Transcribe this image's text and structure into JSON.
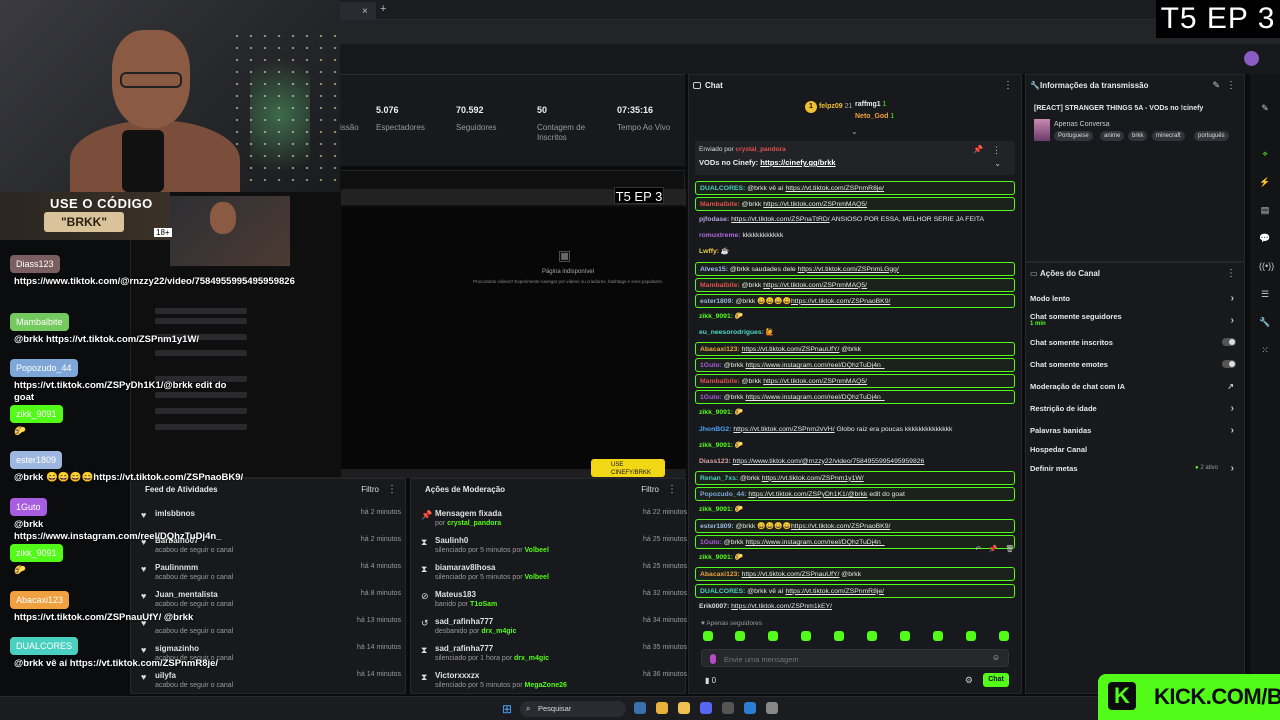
{
  "overlay": {
    "episode_label": "T5 EP 3",
    "episode_label_small": "T5 EP 3",
    "promo": {
      "title": "USE O CÓDIGO",
      "code": "\"BRKK\"",
      "badge": "18+"
    },
    "chat": [
      {
        "name": "Diass123",
        "color": "#d9a3a3",
        "msg": "https://www.tiktok.com/@rnzzy22/video/7584955995495959826"
      },
      {
        "name": "Mambalbite",
        "color": "#74c95f",
        "msg": "@brkk https://vt.tiktok.com/ZSPnm1y1W/"
      },
      {
        "name": "Popozudo_44",
        "color": "#7ea6d9",
        "msg": "https://vt.tiktok.com/ZSPyDh1K1/@brkk edit do goat"
      },
      {
        "name": "zikk_9091",
        "color": "#53fc18",
        "msg": "🌮"
      },
      {
        "name": "ester1809",
        "color": "#9db7e0",
        "msg": "@brkk 😄😄😄😄https://vt.tiktok.com/ZSPnaoBK9/"
      },
      {
        "name": "1Guto",
        "color": "#a85ce0",
        "msg": "@brkk https://www.instagram.com/reel/DQhzTuDj4n_"
      },
      {
        "name": "zikk_9091",
        "color": "#53fc18",
        "msg": "🌮"
      },
      {
        "name": "Abacaxi123",
        "color": "#f0a040",
        "msg": "https://vt.tiktok.com/ZSPnauUfY/ @brkk"
      },
      {
        "name": "DUALCORES",
        "color": "#4ad0c0",
        "msg": "@brkk vê aí https://vt.tiktok.com/ZSPnmR8je/"
      }
    ]
  },
  "browser": {
    "tab_close": "×",
    "tab_new": "+"
  },
  "stats": [
    {
      "value": "",
      "label": "issão"
    },
    {
      "value": "5.076",
      "label": "Espectadores"
    },
    {
      "value": "70.592",
      "label": "Seguidores"
    },
    {
      "value": "50",
      "label": "Contagem de Inscritos"
    },
    {
      "value": "07:35:16",
      "label": "Tempo Ao Vivo"
    }
  ],
  "player": {
    "unavailable": "Página indisponível",
    "unavailable_sub": "Procurando vídeos? Experimente navegar por vídeos ou criadores, hashtags e sons populares.",
    "kick_badge": "USE CINEFY/BRKK"
  },
  "feed": {
    "title": "Feed de Atividades",
    "filter": "Filtro",
    "items": [
      {
        "name": "imlsbbnos",
        "sub": "",
        "time": "há 2 minutos"
      },
      {
        "name": "Barbalho07",
        "sub": "acabou de seguir o canal",
        "time": "há 2 minutos"
      },
      {
        "name": "Paulinnmm",
        "sub": "acabou de seguir o canal",
        "time": "há 4 minutos"
      },
      {
        "name": "Juan_mentalista",
        "sub": "acabou de seguir o canal",
        "time": "há 8 minutos"
      },
      {
        "name": "",
        "sub": "acabou de seguir o canal",
        "time": "há 13 minutos"
      },
      {
        "name": "sigmazinho",
        "sub": "acabou de seguir o canal",
        "time": "há 14 minutos"
      },
      {
        "name": "uilyfa",
        "sub": "acabou de seguir o canal",
        "time": "há 14 minutos"
      }
    ]
  },
  "moderation": {
    "title": "Ações de Moderação",
    "filter": "Filtro",
    "items": [
      {
        "icon": "📌",
        "name": "Mensagem fixada",
        "sub": "por",
        "by": "crystal_pandora",
        "time": "há 22 minutos"
      },
      {
        "icon": "⧗",
        "name": "Saulinh0",
        "sub": "silenciado por 5 minutos por",
        "by": "Volbeel",
        "time": "há 25 minutos"
      },
      {
        "icon": "⧗",
        "name": "biamarav8lhosa",
        "sub": "silenciado por 5 minutos por",
        "by": "Volbeel",
        "time": "há 25 minutos"
      },
      {
        "icon": "⊘",
        "name": "Mateus183",
        "sub": "banido por",
        "by": "T1oSam",
        "time": "há 32 minutos"
      },
      {
        "icon": "↺",
        "name": "sad_rafinha777",
        "sub": "desbanido por",
        "by": "drx_m4gic",
        "time": "há 34 minutos"
      },
      {
        "icon": "⧗",
        "name": "sad_rafinha777",
        "sub": "silenciado por 1 hora por",
        "by": "drx_m4gic",
        "time": "há 35 minutos"
      },
      {
        "icon": "⧗",
        "name": "Victorxxxzx",
        "sub": "silenciado por 5 minutos por",
        "by": "MegaZone26",
        "time": "há 36 minutos"
      }
    ]
  },
  "chat": {
    "title": "Chat",
    "leaderboard": [
      {
        "name": "felpz09",
        "count": "21"
      },
      {
        "name": "raffmg1",
        "count": "1"
      },
      {
        "name": "Neto_God",
        "count": "1"
      }
    ],
    "pinned": {
      "sender_prefix": "Enviado por",
      "sender": "crystal_pandora",
      "msg_text": "VODs no Cinefy: ",
      "msg_link": "https://cinefy.gg/brkk"
    },
    "messages": [
      {
        "name": "DUALCORES:",
        "color": "#4ad0c0",
        "text": " @brkk vê aí ",
        "link": "https://vt.tiktok.com/ZSPnmR8je/",
        "hl": true
      },
      {
        "name": "Mambalbite:",
        "color": "#e0504f",
        "text": " @brkk ",
        "link": "https://vt.tiktok.com/ZSPnmMAQ5/",
        "hl": true
      },
      {
        "name": "pjfodase:",
        "color": "#b9a3e0",
        "text": " ",
        "link": "https://vt.tiktok.com/ZSPnaTtRD/",
        "tail": " ANSIOSO POR ESSA, MELHOR SERIE JA FEITA",
        "hl": false
      },
      {
        "name": "romuxtreme:",
        "color": "#b06cdf",
        "text": " kkkkkkkkkkkk",
        "link": "",
        "hl": false
      },
      {
        "name": "Lwffy:",
        "color": "#f0d040",
        "text": " ☕",
        "link": "",
        "hl": false
      },
      {
        "name": "Alves15:",
        "color": "#9fb7ff",
        "text": " @brkk saudades dele ",
        "link": "https://vt.tiktok.com/ZSPnmLGgg/",
        "hl": true
      },
      {
        "name": "Mambalbite:",
        "color": "#e0504f",
        "text": " @brkk ",
        "link": "https://vt.tiktok.com/ZSPnmMAQ5/",
        "hl": true
      },
      {
        "name": "ester1809:",
        "color": "#9db7e0",
        "text": " @brkk 😄😄😄😄",
        "link": "https://vt.tiktok.com/ZSPnaoBK9/",
        "hl": true
      },
      {
        "name": "zikk_9091:",
        "color": "#53fc18",
        "text": " 🌮",
        "link": "",
        "hl": false
      },
      {
        "name": "eu_neesorodrigues:",
        "color": "#4fd7c4",
        "text": " 🙋",
        "link": "",
        "hl": false
      },
      {
        "name": "Abacaxi123:",
        "color": "#f0a040",
        "text": " ",
        "link": "https://vt.tiktok.com/ZSPnauUfY/",
        "tail": " @brkk",
        "hl": true
      },
      {
        "name": "1Guto:",
        "color": "#a85ce0",
        "text": " @brkk ",
        "link": "https://www.instagram.com/reel/DQhzTuDj4n_",
        "hl": true
      },
      {
        "name": "Mambalbite:",
        "color": "#e0504f",
        "text": " @brkk ",
        "link": "https://vt.tiktok.com/ZSPnmMAQ5/",
        "hl": true
      },
      {
        "name": "1Guto:",
        "color": "#a85ce0",
        "text": " @brkk ",
        "link": "https://www.instagram.com/reel/DQhzTuDj4n_",
        "hl": true
      },
      {
        "name": "zikk_9091:",
        "color": "#53fc18",
        "text": " 🌮",
        "link": "",
        "hl": false
      },
      {
        "name": "JhonBG2:",
        "color": "#4aa3ff",
        "text": " ",
        "link": "https://vt.tiktok.com/ZSPnm2vVH/",
        "tail": " Globo raiz era poucas kkkkkkkkkkkkkk",
        "hl": false
      },
      {
        "name": "zikk_9091:",
        "color": "#53fc18",
        "text": " 🌮",
        "link": "",
        "hl": false
      },
      {
        "name": "Diass123:",
        "color": "#d9a3a3",
        "text": " ",
        "link": "https://www.tiktok.com/@rnzzy22/video/7584955995495959826",
        "hl": false
      },
      {
        "name": "Renan_7xs:",
        "color": "#4ad0c0",
        "text": " @brkk ",
        "link": "https://vt.tiktok.com/ZSPnm1y1W/",
        "hl": true
      },
      {
        "name": "Popozudo_44:",
        "color": "#7ea6d9",
        "text": " ",
        "link": "https://vt.tiktok.com/ZSPyDh1K1/@brkk",
        "tail": " edit do goat",
        "hl": true
      },
      {
        "name": "zikk_9091:",
        "color": "#53fc18",
        "text": " 🌮",
        "link": "",
        "hl": false
      },
      {
        "name": "ester1809:",
        "color": "#9db7e0",
        "text": " @brkk 😄😄😄😄",
        "link": "https://vt.tiktok.com/ZSPnaoBK9/",
        "hl": true
      },
      {
        "name": "1Guto:",
        "color": "#a85ce0",
        "text": " @brkk ",
        "link": "https://www.instagram.com/reel/DQhzTuDj4n_",
        "hl": true
      },
      {
        "name": "zikk_9091:",
        "color": "#53fc18",
        "text": " 🌮",
        "link": "",
        "hl": false
      },
      {
        "name": "Abacaxi123:",
        "color": "#f0a040",
        "text": " ",
        "link": "https://vt.tiktok.com/ZSPnauUfY/",
        "tail": " @brkk",
        "hl": true
      },
      {
        "name": "DUALCORES:",
        "color": "#4ad0c0",
        "text": " @brkk vê aí ",
        "link": "https://vt.tiktok.com/ZSPnmR8je/",
        "hl": true
      },
      {
        "name": "Erik0007:",
        "color": "#dddddd",
        "text": " ",
        "link": "https://vt.tiktok.com/ZSPnm1kEY/",
        "hl": false
      }
    ],
    "followers_only": "Apenas seguidores",
    "input_placeholder": "Envie uma mensagem",
    "user_count": "0",
    "send_label": "Chat"
  },
  "stream_info": {
    "title": "Informações da transmissão",
    "stream_title": "[REACT] STRANGER THINGS 5A - VODs no !cinefy",
    "category": "Apenas Conversa",
    "tags": [
      "Portuguese",
      "anime",
      "brkk",
      "minecraft",
      "português"
    ]
  },
  "channel_actions": {
    "title": "Ações do Canal",
    "items": [
      {
        "label": "Modo lento",
        "sub": "",
        "kind": "chevron",
        "status": ""
      },
      {
        "label": "Chat somente seguidores",
        "sub": "1 min",
        "kind": "chevron",
        "status": ""
      },
      {
        "label": "Chat somente inscritos",
        "sub": "",
        "kind": "toggle",
        "status": ""
      },
      {
        "label": "Chat somente emotes",
        "sub": "",
        "kind": "toggle",
        "status": ""
      },
      {
        "label": "Moderação de chat com IA",
        "sub": "",
        "kind": "external",
        "status": ""
      },
      {
        "label": "Restrição de idade",
        "sub": "",
        "kind": "chevron",
        "status": ""
      },
      {
        "label": "Palavras banidas",
        "sub": "",
        "kind": "chevron",
        "status": ""
      },
      {
        "label": "Hospedar Canal",
        "sub": "",
        "kind": "none",
        "status": ""
      },
      {
        "label": "Definir metas",
        "sub": "",
        "kind": "chevron",
        "status": "2 ativo"
      }
    ]
  },
  "taskbar": {
    "search_label": "Pesquisar"
  },
  "kick_logo": {
    "letter": "K",
    "text": "KICK.COM/BR"
  },
  "colors": {
    "accent": "#53fc18",
    "bg": "#18191c"
  }
}
